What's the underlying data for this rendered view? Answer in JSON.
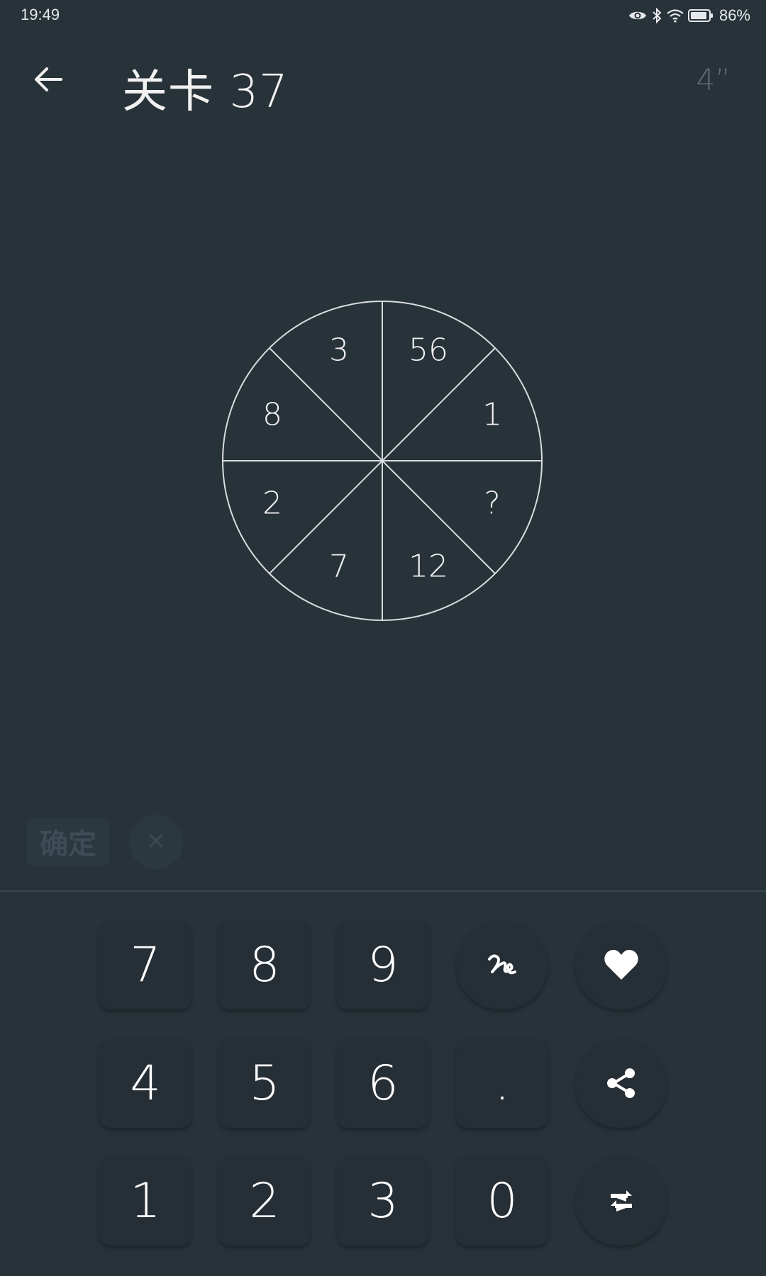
{
  "status_bar": {
    "time": "19:49",
    "battery": "86%",
    "icons": [
      "eye-icon",
      "bluetooth-icon",
      "wifi-icon",
      "battery-icon"
    ]
  },
  "header": {
    "back_icon": "arrow-left-icon",
    "title": "关卡 37",
    "timer": "4”"
  },
  "puzzle": {
    "type": "circle-8-slices",
    "slices": {
      "top_left": "3",
      "top_right": "56",
      "right_top": "1",
      "right_bottom": "?",
      "bottom_right": "12",
      "bottom_left": "7",
      "left_bottom": "2",
      "left_top": "8"
    }
  },
  "answer": {
    "confirm_label": "确定",
    "clear_icon": "close-icon"
  },
  "keypad": {
    "k7": "7",
    "k8": "8",
    "k9": "9",
    "k4": "4",
    "k5": "5",
    "k6": "6",
    "k1": "1",
    "k2": "2",
    "k3": "3",
    "dot": ".",
    "k0": "0",
    "icons": {
      "hint": "scribble-icon",
      "favorite": "heart-icon",
      "share": "share-icon",
      "swap": "swap-arrows-icon"
    }
  },
  "colors": {
    "background": "#283239",
    "key": "#262e36",
    "line": "#d9dcde",
    "muted": "#5f6b73"
  }
}
